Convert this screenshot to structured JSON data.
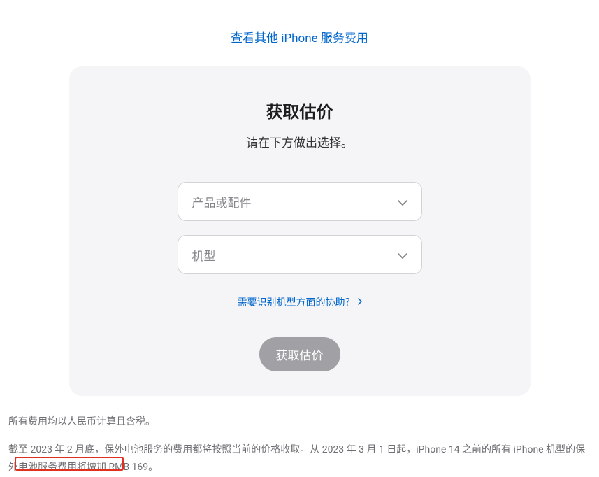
{
  "topLink": "查看其他 iPhone 服务费用",
  "card": {
    "title": "获取估价",
    "subtitle": "请在下方做出选择。",
    "dropdown1": "产品或配件",
    "dropdown2": "机型",
    "helpLink": "需要识别机型方面的协助？",
    "submitButton": "获取估价"
  },
  "footer": {
    "para1": "所有费用均以人民币计算且含税。",
    "para2": "截至 2023 年 2 月底，保外电池服务的费用都将按照当前的价格收取。从 2023 年 3 月 1 日起，iPhone 14 之前的所有 iPhone 机型的保外电池服务费用将增加 RMB 169。"
  }
}
